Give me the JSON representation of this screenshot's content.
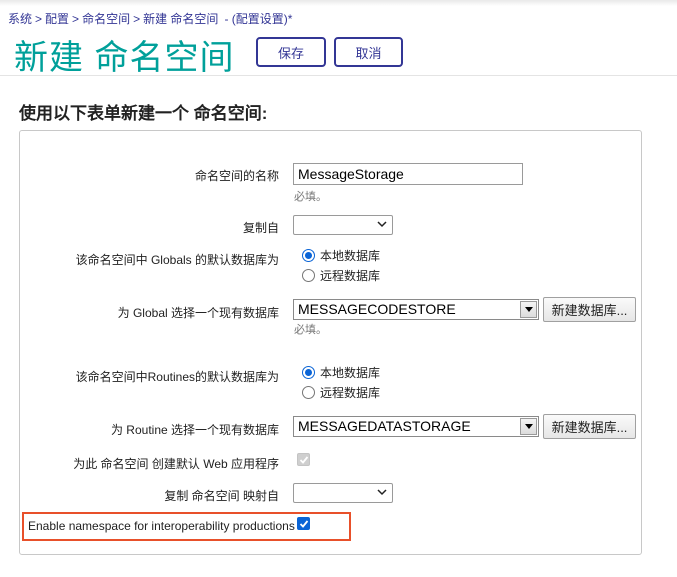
{
  "breadcrumb": {
    "items": [
      "系统",
      "配置",
      "命名空间",
      "新建 命名空间"
    ],
    "separator": ">",
    "suffix": "- (配置设置)*"
  },
  "header": {
    "title": "新建 命名空间",
    "save_label": "保存",
    "cancel_label": "取消"
  },
  "form": {
    "instruction": "使用以下表单新建一个 命名空间:",
    "name_label": "命名空间的名称",
    "name_value": "MessageStorage",
    "name_hint": "必填。",
    "copy_from_label": "复制自",
    "copy_from_value": "",
    "globals_db_label": "该命名空间中 Globals 的默认数据库为",
    "globals_local_label": "本地数据库",
    "globals_remote_label": "远程数据库",
    "global_db_select_label": "为 Global 选择一个现有数据库",
    "global_db_value": "MESSAGECODESTORE",
    "global_db_hint": "必填。",
    "new_db_button_label": "新建数据库...",
    "routines_db_label": "该命名空间中Routines的默认数据库为",
    "routines_local_label": "本地数据库",
    "routines_remote_label": "远程数据库",
    "routine_db_select_label": "为 Routine 选择一个现有数据库",
    "routine_db_value": "MESSAGEDATASTORAGE",
    "new_db_button_label_2": "新建数据库...",
    "web_app_label": "为此 命名空间 创建默认 Web 应用程序",
    "copy_mapping_label": "复制 命名空间 映射自",
    "copy_mapping_value": "",
    "interop_label": "Enable namespace for interoperability productions"
  },
  "colors": {
    "title": "#00A09A",
    "accent": "#333695",
    "checkbox": "#0a64d6",
    "highlight": "#e8502a"
  }
}
